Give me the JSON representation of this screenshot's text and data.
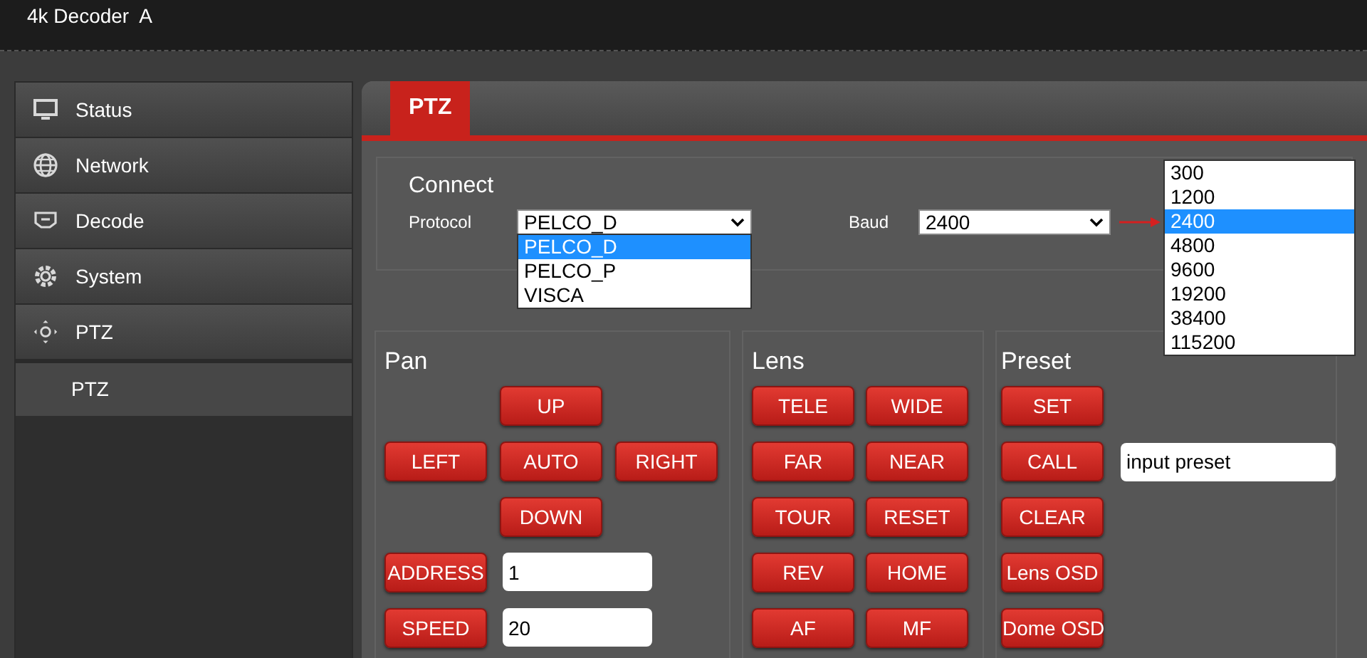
{
  "header": {
    "title": "4k Decoder  A"
  },
  "sidebar": {
    "items": [
      {
        "kind": "monitor",
        "label": "Status"
      },
      {
        "kind": "globe",
        "label": "Network"
      },
      {
        "kind": "display",
        "label": "Decode"
      },
      {
        "kind": "gear",
        "label": "System"
      },
      {
        "kind": "ptz",
        "label": "PTZ",
        "children": [
          {
            "label": "PTZ"
          }
        ]
      }
    ]
  },
  "tabs": [
    {
      "label": "PTZ",
      "selected": true
    }
  ],
  "connect": {
    "title": "Connect",
    "protocol": {
      "label": "Protocol",
      "value": "PELCO_D",
      "expanded": true,
      "options": [
        {
          "label": "PELCO_D",
          "selected": true
        },
        {
          "label": "PELCO_P",
          "selected": false
        },
        {
          "label": "VISCA",
          "selected": false
        }
      ]
    },
    "baud": {
      "label": "Baud",
      "value": "2400",
      "expanded": true,
      "options": [
        {
          "label": "300",
          "selected": false
        },
        {
          "label": "1200",
          "selected": false
        },
        {
          "label": "2400",
          "selected": true
        },
        {
          "label": "4800",
          "selected": false
        },
        {
          "label": "9600",
          "selected": false
        },
        {
          "label": "19200",
          "selected": false
        },
        {
          "label": "38400",
          "selected": false
        },
        {
          "label": "115200",
          "selected": false
        }
      ]
    }
  },
  "pan": {
    "title": "Pan",
    "dpad": {
      "up": "UP",
      "left": "LEFT",
      "center": "AUTO",
      "right": "RIGHT",
      "down": "DOWN"
    },
    "fields": [
      {
        "label": "ADDRESS",
        "value": "1"
      },
      {
        "label": "SPEED",
        "value": "20"
      }
    ]
  },
  "lens": {
    "title": "Lens",
    "buttons": [
      "TELE",
      "WIDE",
      "FAR",
      "NEAR",
      "TOUR",
      "RESET",
      "REV",
      "HOME",
      "AF",
      "MF"
    ]
  },
  "preset": {
    "title": "Preset",
    "rows": [
      {
        "button": "SET"
      },
      {
        "button": "CALL",
        "field": {
          "value": "input preset"
        }
      },
      {
        "button": "CLEAR"
      },
      {
        "button": "Lens OSD"
      },
      {
        "button": "Dome OSD"
      }
    ]
  }
}
